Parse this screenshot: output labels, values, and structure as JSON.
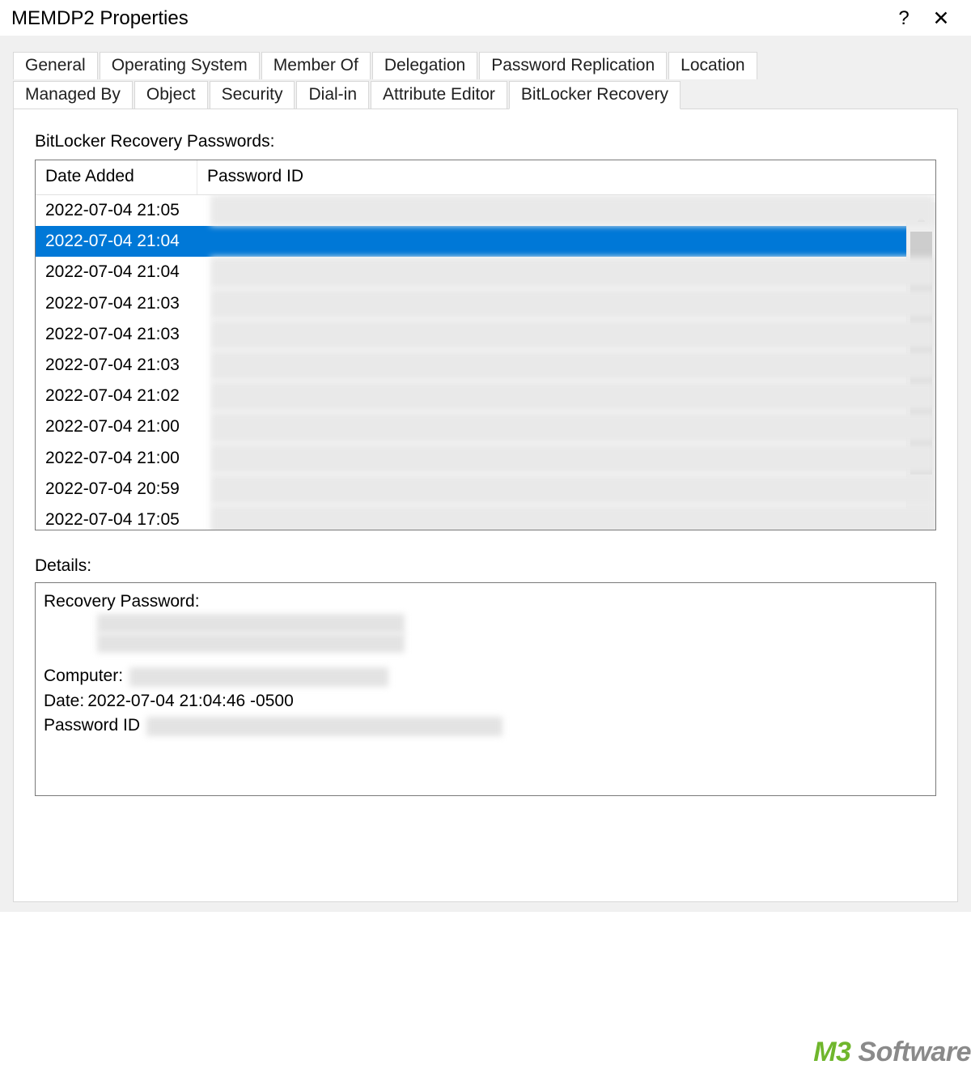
{
  "title_bar": {
    "title": "MEMDP2 Properties",
    "help": "?",
    "close": "✕"
  },
  "tabs": {
    "row1": [
      "General",
      "Operating System",
      "Member Of",
      "Delegation",
      "Password Replication",
      "Location"
    ],
    "row2": [
      "Managed By",
      "Object",
      "Security",
      "Dial-in",
      "Attribute Editor",
      "BitLocker Recovery"
    ],
    "active": "BitLocker Recovery"
  },
  "content": {
    "list_label": "BitLocker Recovery Passwords:",
    "columns": {
      "date": "Date Added",
      "pid": "Password ID"
    },
    "rows": [
      {
        "date": "2022-07-04 21:05",
        "selected": false
      },
      {
        "date": "2022-07-04 21:04",
        "selected": true
      },
      {
        "date": "2022-07-04 21:04",
        "selected": false
      },
      {
        "date": "2022-07-04 21:03",
        "selected": false
      },
      {
        "date": "2022-07-04 21:03",
        "selected": false
      },
      {
        "date": "2022-07-04 21:03",
        "selected": false
      },
      {
        "date": "2022-07-04 21:02",
        "selected": false
      },
      {
        "date": "2022-07-04 21:00",
        "selected": false
      },
      {
        "date": "2022-07-04 21:00",
        "selected": false
      },
      {
        "date": "2022-07-04 20:59",
        "selected": false
      },
      {
        "date": "2022-07-04 17:05",
        "selected": false
      }
    ],
    "scroll": {
      "up": "▴",
      "down": "▾"
    },
    "details_label": "Details:",
    "details": {
      "recovery_password_label": "Recovery Password:",
      "computer_label": "Computer:",
      "date_label": "Date:",
      "date_value": "2022-07-04 21:04:46 -0500",
      "password_id_label": "Password ID"
    }
  },
  "watermark": {
    "m3": "M3",
    "soft": " Software"
  }
}
